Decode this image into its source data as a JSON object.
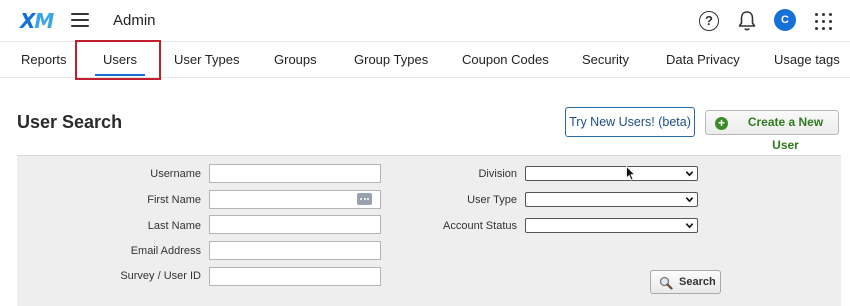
{
  "topbar": {
    "logo_x": "X",
    "logo_m": "M",
    "title": "Admin",
    "help_glyph": "?",
    "avatar_initial": "C"
  },
  "tabs": [
    {
      "label": "Reports"
    },
    {
      "label": "Users",
      "active": true
    },
    {
      "label": "User Types"
    },
    {
      "label": "Groups"
    },
    {
      "label": "Group Types"
    },
    {
      "label": "Coupon Codes"
    },
    {
      "label": "Security"
    },
    {
      "label": "Data Privacy"
    },
    {
      "label": "Usage tags"
    }
  ],
  "header": {
    "title": "User Search",
    "try_button": "Try New Users! (beta)",
    "create_button": "Create a New User"
  },
  "search_form": {
    "fields": {
      "username": {
        "label": "Username",
        "value": ""
      },
      "first_name": {
        "label": "First Name",
        "value": ""
      },
      "last_name": {
        "label": "Last Name",
        "value": ""
      },
      "email": {
        "label": "Email Address",
        "value": ""
      },
      "survey_user_id": {
        "label": "Survey / User ID",
        "value": ""
      }
    },
    "selects": {
      "division": {
        "label": "Division",
        "value": ""
      },
      "user_type": {
        "label": "User Type",
        "value": ""
      },
      "account_status": {
        "label": "Account Status",
        "value": ""
      }
    },
    "search_button": "Search"
  },
  "colors": {
    "brand_blue": "#1570d8",
    "highlight_red": "#c0202e",
    "create_green": "#2f7a1e",
    "panel_bg": "#eeeeee"
  },
  "icons": [
    "hamburger-icon",
    "help-icon",
    "bell-icon",
    "apps-grid-icon",
    "plus-circle-icon",
    "more-dots-icon",
    "chevron-down-icon",
    "magnifier-icon",
    "mouse-cursor-icon"
  ]
}
